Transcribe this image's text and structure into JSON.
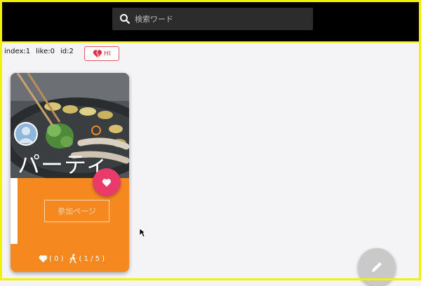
{
  "search": {
    "placeholder": "検索ワード"
  },
  "info": {
    "index": "index:1",
    "like": "like:0",
    "id": "id:2"
  },
  "hi_button": {
    "label": "HI",
    "icon": "broken-heart-icon"
  },
  "card": {
    "title": "パーティ",
    "join_label": "参加ページ",
    "likes": "( 0 )",
    "participants": "( 1 / 5 )",
    "accent": "#f5891f"
  },
  "colors": {
    "favorite": "#e93a6a",
    "highlight": "#f2f200"
  }
}
